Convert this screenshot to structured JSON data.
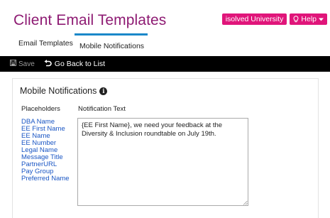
{
  "page": {
    "title": "Client Email Templates"
  },
  "header": {
    "university_label": "isolved University",
    "help_label": "Help",
    "accent_color": "#e0157a",
    "title_color": "#8e1b73"
  },
  "tabs": [
    {
      "label": "Email Templates",
      "active": false
    },
    {
      "label": "Mobile Notifications",
      "active": true
    }
  ],
  "toolbar": {
    "save_label": "Save",
    "back_label": "Go Back to List"
  },
  "section": {
    "title": "Mobile Notifications",
    "placeholders_header": "Placeholders",
    "notification_header": "Notification Text"
  },
  "placeholders": [
    "DBA Name",
    "EE First Name",
    "EE Name",
    "EE Number",
    "Legal Name",
    "Message Title",
    "PartnerURL",
    "Pay Group",
    "Preferred Name"
  ],
  "notification": {
    "text": "{EE First Name}, we need your feedback at the Diversity & Inclusion roundtable on July 19th."
  }
}
